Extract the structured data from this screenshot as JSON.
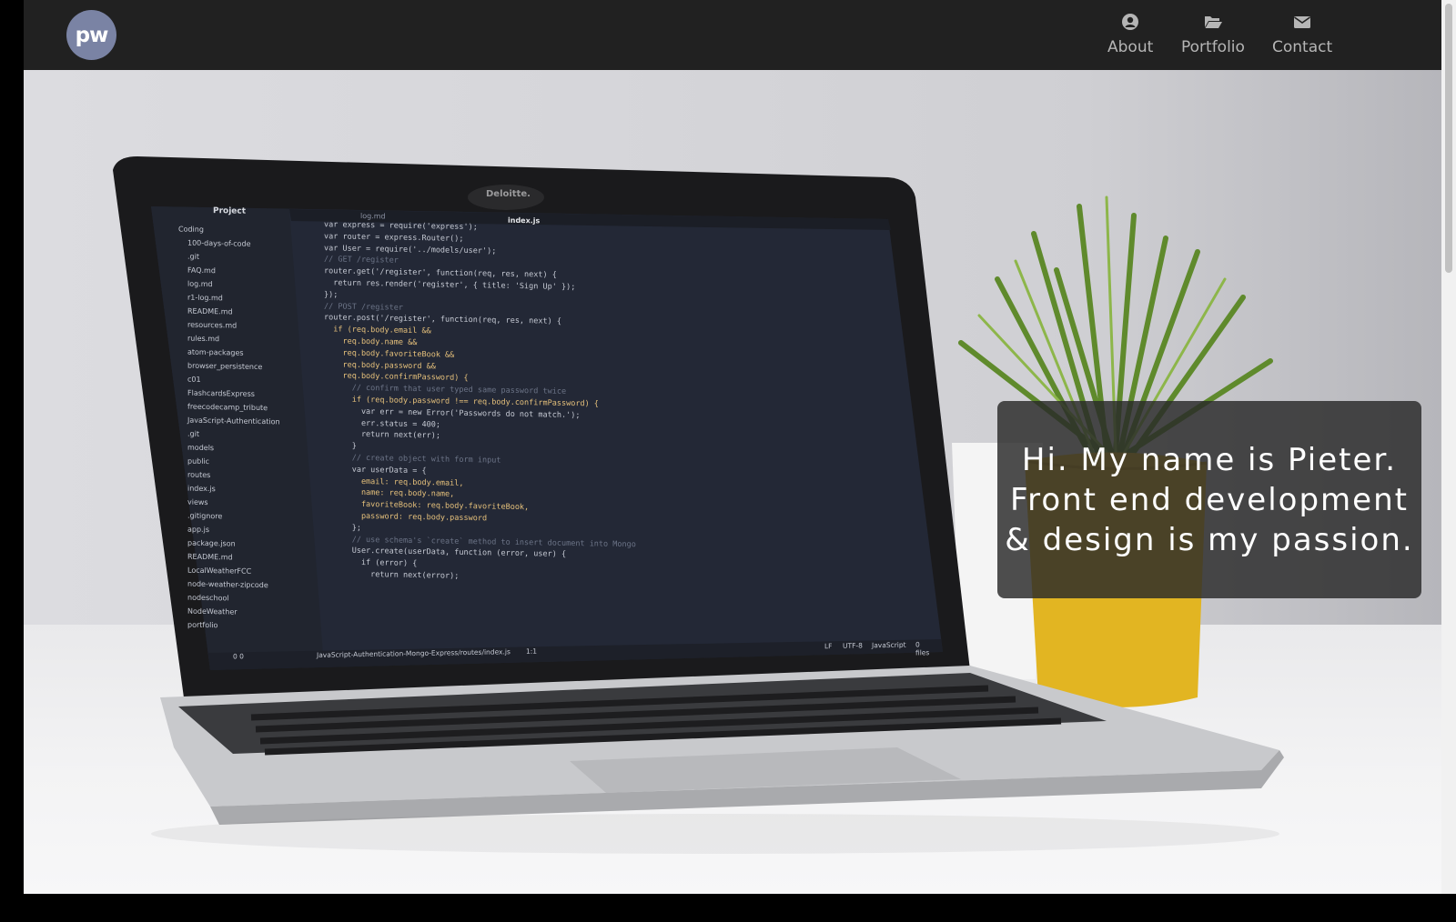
{
  "logo": {
    "text": "pw"
  },
  "nav": {
    "items": [
      {
        "label": "About",
        "icon": "user-circle-icon"
      },
      {
        "label": "Portfolio",
        "icon": "folder-open-icon"
      },
      {
        "label": "Contact",
        "icon": "envelope-icon"
      }
    ]
  },
  "hero": {
    "lines": [
      "Hi. My name is Pieter.",
      "Front end development",
      "& design is my passion."
    ]
  },
  "colors": {
    "navbar_bg": "#212121",
    "logo_bg": "#7a83a4",
    "nav_text": "#b5b5b5",
    "card_bg": "#282828"
  },
  "laptop": {
    "camera_label": "Deloitte.",
    "editor": {
      "sidebar_title": "Project",
      "tabs": [
        "log.md",
        "index.js"
      ],
      "tree": [
        "Coding",
        "100-days-of-code",
        ".git",
        "FAQ.md",
        "log.md",
        "r1-log.md",
        "README.md",
        "resources.md",
        "rules.md",
        "atom-packages",
        "browser_persistence",
        "c01",
        "FlashcardsExpress",
        "freecodecamp_tribute",
        "JavaScript-Authentication",
        ".git",
        "models",
        "public",
        "routes",
        "index.js",
        "views",
        ".gitignore",
        "app.js",
        "package.json",
        "README.md",
        "LocalWeatherFCC",
        "node-weather-zipcode",
        "nodeschool",
        "NodeWeather",
        "portfolio"
      ],
      "code": [
        "var express = require('express');",
        "var router = express.Router();",
        "var User = require('../models/user');",
        "",
        "// GET /register",
        "router.get('/register', function(req, res, next) {",
        "  return res.render('register', { title: 'Sign Up' });",
        "});",
        "",
        "// POST /register",
        "router.post('/register', function(req, res, next) {",
        "  if (req.body.email &&",
        "    req.body.name &&",
        "    req.body.favoriteBook &&",
        "    req.body.password &&",
        "    req.body.confirmPassword) {",
        "",
        "      // confirm that user typed same password twice",
        "      if (req.body.password !== req.body.confirmPassword) {",
        "        var err = new Error('Passwords do not match.');",
        "        err.status = 400;",
        "        return next(err);",
        "      }",
        "",
        "      // create object with form input",
        "      var userData = {",
        "        email: req.body.email,",
        "        name: req.body.name,",
        "        favoriteBook: req.body.favoriteBook,",
        "        password: req.body.password",
        "      };",
        "",
        "      // use schema's `create` method to insert document into Mongo",
        "      User.create(userData, function (error, user) {",
        "        if (error) {",
        "          return next(error);"
      ],
      "status_path": "JavaScript-Authentication-Mongo-Express/routes/index.js",
      "status_pos": "1:1",
      "status_left": "0  0",
      "status_right": [
        "LF",
        "UTF-8",
        "JavaScript",
        "0 files"
      ]
    }
  }
}
